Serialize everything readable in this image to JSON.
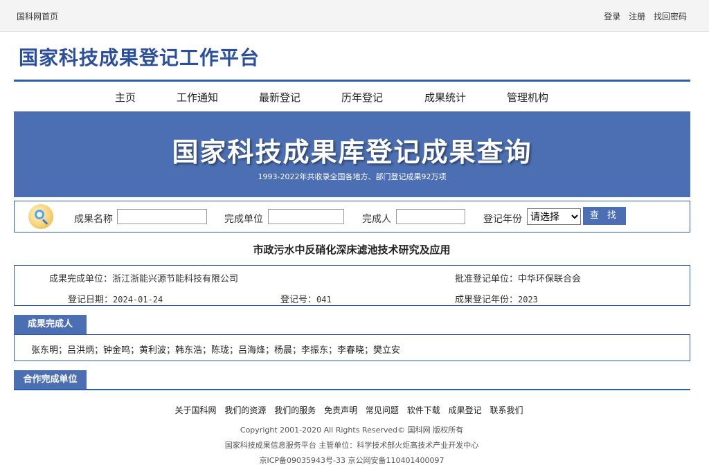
{
  "topbar": {
    "home": "国科网首页",
    "links": [
      "登录",
      "注册",
      "找回密码"
    ]
  },
  "logo": "国家科技成果登记工作平台",
  "nav": [
    "主页",
    "工作通知",
    "最新登记",
    "历年登记",
    "成果统计",
    "管理机构"
  ],
  "banner": {
    "title": "国家科技成果库登记成果查询",
    "subtitle": "1993-2022年共收录全国各地方、部门登记成果92万项"
  },
  "search": {
    "label_name": "成果名称",
    "label_unit": "完成单位",
    "label_person": "完成人",
    "label_year": "登记年份",
    "year_selected": "请选择",
    "button": "查 找"
  },
  "result": {
    "title": "市政污水中反硝化深床滤池技术研究及应用",
    "unit_label": "成果完成单位：",
    "unit_value": "浙江浙能兴源节能科技有限公司",
    "approve_label": "批准登记单位：",
    "approve_value": "中华环保联合会",
    "date_label": "登记日期：",
    "date_value": "2024-01-24",
    "regno_label": "登记号：",
    "regno_value": "041",
    "year_label": "成果登记年份：",
    "year_value": "2023"
  },
  "sections": {
    "persons_title": "成果完成人",
    "persons": "张东明；吕洪炳；钟金鸣；黄利波；韩东浩；陈珑；吕海烽；杨晨；李振东；李春晓；樊立安",
    "partners_title": "合作完成单位"
  },
  "footer": {
    "links": [
      "关于国科网",
      "我们的资源",
      "我们的服务",
      "免责声明",
      "常见问题",
      "软件下载",
      "成果登记",
      "联系我们"
    ],
    "copyright": "Copyright 2001-2020 All Rights Reserved© 国科网 版权所有",
    "platform": "国家科技成果信息服务平台 主管单位：科学技术部火炬高技术产业开发中心",
    "icp": "京ICP备09035943号-33 京公网安备110401400097"
  }
}
